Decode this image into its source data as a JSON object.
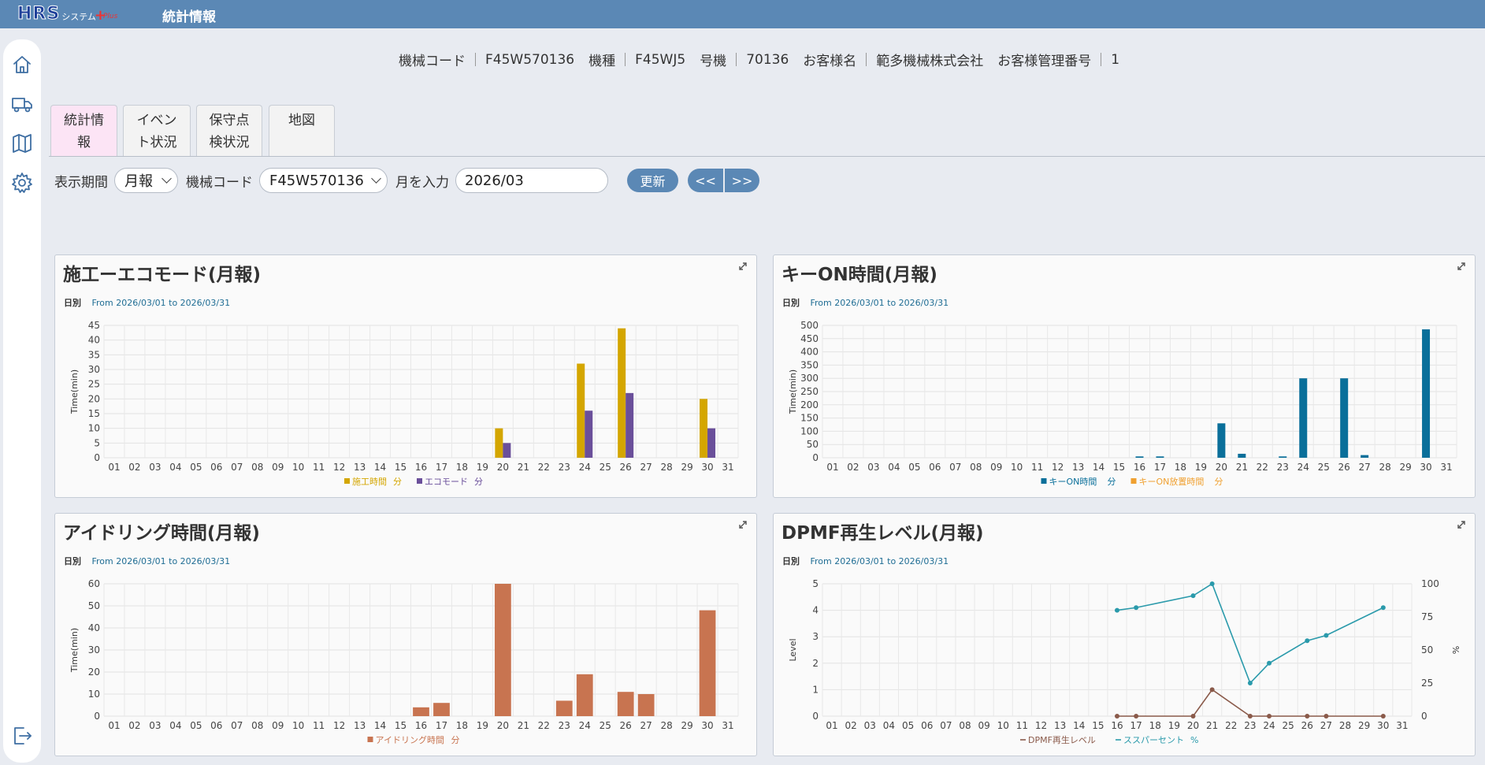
{
  "header": {
    "logo": {
      "brand": "HRS",
      "suffix": "システム",
      "plus": "+",
      "plus_sub": "Plus"
    },
    "title": "統計情報"
  },
  "sidebar": {
    "items": [
      {
        "icon": "home-icon"
      },
      {
        "icon": "truck-icon"
      },
      {
        "icon": "map-icon"
      },
      {
        "icon": "gear-icon"
      },
      {
        "icon": "logout-icon"
      }
    ]
  },
  "machine_info": {
    "code_label": "機械コード",
    "code_value": "F45W570136",
    "model_label": "機種",
    "model_value": "F45WJ5",
    "unit_label": "号機",
    "unit_value": "70136",
    "customer_label": "お客様名",
    "customer_value": "範多機械株式会社",
    "mgmt_label": "お客様管理番号",
    "mgmt_value": "1"
  },
  "tabs": [
    {
      "line1": "統計情",
      "line2": "報",
      "active": true
    },
    {
      "line1": "イベン",
      "line2": "ト状況",
      "active": false
    },
    {
      "line1": "保守点",
      "line2": "検状況",
      "active": false
    },
    {
      "line1": "地図",
      "line2": "",
      "active": false
    }
  ],
  "controls": {
    "period_label": "表示期間",
    "period_value": "月報",
    "machine_label": "機械コード",
    "machine_value": "F45W570136",
    "month_label": "月を入力",
    "month_value": "2026/03",
    "refresh_label": "更新",
    "prev_label": "<<",
    "next_label": ">>"
  },
  "panels": [
    {
      "title": "施工ーエコモード(月報)",
      "day_label": "日別",
      "range": "From 2026/03/01 to 2026/03/31"
    },
    {
      "title": "キーON時間(月報)",
      "day_label": "日別",
      "range": "From 2026/03/01 to 2026/03/31"
    },
    {
      "title": "アイドリング時間(月報)",
      "day_label": "日別",
      "range": "From 2026/03/01 to 2026/03/31"
    },
    {
      "title": "DPMF再生レベル(月報)",
      "day_label": "日別",
      "range": "From 2026/03/01 to 2026/03/31"
    }
  ],
  "chart_data": [
    {
      "type": "bar",
      "categories": [
        "01",
        "02",
        "03",
        "04",
        "05",
        "06",
        "07",
        "08",
        "09",
        "10",
        "11",
        "12",
        "13",
        "14",
        "15",
        "16",
        "17",
        "18",
        "19",
        "20",
        "21",
        "22",
        "23",
        "24",
        "25",
        "26",
        "27",
        "28",
        "29",
        "30",
        "31"
      ],
      "ylabel": "Time(min)",
      "ylim": [
        0,
        45
      ],
      "yticks": [
        0,
        5,
        10,
        15,
        20,
        25,
        30,
        35,
        40,
        45
      ],
      "grid": true,
      "legend_position": "bottom",
      "series": [
        {
          "name": "施工時間",
          "unit": "分",
          "color": "#d4a600",
          "values": [
            0,
            0,
            0,
            0,
            0,
            0,
            0,
            0,
            0,
            0,
            0,
            0,
            0,
            0,
            0,
            0,
            0,
            0,
            0,
            10,
            0,
            0,
            0,
            32,
            0,
            44,
            0,
            0,
            0,
            20,
            0
          ]
        },
        {
          "name": "エコモード",
          "unit": "分",
          "color": "#6a4f9a",
          "values": [
            0,
            0,
            0,
            0,
            0,
            0,
            0,
            0,
            0,
            0,
            0,
            0,
            0,
            0,
            0,
            0,
            0,
            0,
            0,
            5,
            0,
            0,
            0,
            16,
            0,
            22,
            0,
            0,
            0,
            10,
            0
          ]
        }
      ]
    },
    {
      "type": "bar",
      "categories": [
        "01",
        "02",
        "03",
        "04",
        "05",
        "06",
        "07",
        "08",
        "09",
        "10",
        "11",
        "12",
        "13",
        "14",
        "15",
        "16",
        "17",
        "18",
        "19",
        "20",
        "21",
        "22",
        "23",
        "24",
        "25",
        "26",
        "27",
        "28",
        "29",
        "30",
        "31"
      ],
      "ylabel": "Time(min)",
      "ylim": [
        0,
        500
      ],
      "yticks": [
        0,
        50,
        100,
        150,
        200,
        250,
        300,
        350,
        400,
        450,
        500
      ],
      "grid": true,
      "legend_position": "bottom",
      "series": [
        {
          "name": "キーON時間",
          "unit": "分",
          "color": "#0a6f9a",
          "values": [
            0,
            0,
            0,
            0,
            0,
            0,
            0,
            0,
            0,
            0,
            0,
            0,
            0,
            0,
            0,
            5,
            5,
            0,
            0,
            130,
            15,
            0,
            5,
            300,
            0,
            300,
            10,
            0,
            0,
            485,
            0
          ]
        },
        {
          "name": "キーON放置時間",
          "unit": "分",
          "color": "#f0a030",
          "values": [
            0,
            0,
            0,
            0,
            0,
            0,
            0,
            0,
            0,
            0,
            0,
            0,
            0,
            0,
            0,
            0,
            0,
            0,
            0,
            0,
            0,
            0,
            0,
            0,
            0,
            0,
            0,
            0,
            0,
            0,
            0
          ]
        }
      ]
    },
    {
      "type": "bar",
      "categories": [
        "01",
        "02",
        "03",
        "04",
        "05",
        "06",
        "07",
        "08",
        "09",
        "10",
        "11",
        "12",
        "13",
        "14",
        "15",
        "16",
        "17",
        "18",
        "19",
        "20",
        "21",
        "22",
        "23",
        "24",
        "25",
        "26",
        "27",
        "28",
        "29",
        "30",
        "31"
      ],
      "ylabel": "Time(min)",
      "ylim": [
        0,
        60
      ],
      "yticks": [
        0,
        10,
        20,
        30,
        40,
        50,
        60
      ],
      "grid": true,
      "legend_position": "bottom",
      "series": [
        {
          "name": "アイドリング時間",
          "unit": "分",
          "color": "#c87450",
          "values": [
            0,
            0,
            0,
            0,
            0,
            0,
            0,
            0,
            0,
            0,
            0,
            0,
            0,
            0,
            0,
            4,
            6,
            0,
            0,
            60,
            0,
            0,
            7,
            19,
            0,
            11,
            10,
            0,
            0,
            48,
            0
          ]
        }
      ]
    },
    {
      "type": "line",
      "categories": [
        "01",
        "02",
        "03",
        "04",
        "05",
        "06",
        "07",
        "08",
        "09",
        "10",
        "11",
        "12",
        "13",
        "14",
        "15",
        "16",
        "17",
        "18",
        "19",
        "20",
        "21",
        "22",
        "23",
        "24",
        "25",
        "26",
        "27",
        "28",
        "29",
        "30",
        "31"
      ],
      "ylabel": "Level",
      "ylim": [
        0,
        5
      ],
      "yticks": [
        0,
        1,
        2,
        3,
        4,
        5
      ],
      "y2label": "%",
      "y2lim": [
        0,
        100
      ],
      "y2ticks": [
        0,
        25,
        50,
        75,
        100
      ],
      "grid": true,
      "legend_position": "bottom",
      "series": [
        {
          "name": "DPMF再生レベル",
          "unit": "",
          "color": "#8a5a4a",
          "axis": "left",
          "points": [
            [
              "16",
              0
            ],
            [
              "17",
              0
            ],
            [
              "20",
              0
            ],
            [
              "21",
              1
            ],
            [
              "23",
              0
            ],
            [
              "24",
              0
            ],
            [
              "26",
              0
            ],
            [
              "27",
              0
            ],
            [
              "30",
              0
            ]
          ]
        },
        {
          "name": "ススパーセント",
          "unit": "%",
          "color": "#2a9aab",
          "axis": "right",
          "points": [
            [
              "16",
              80
            ],
            [
              "17",
              82
            ],
            [
              "20",
              91
            ],
            [
              "21",
              100
            ],
            [
              "23",
              25
            ],
            [
              "24",
              40
            ],
            [
              "26",
              57
            ],
            [
              "27",
              61
            ],
            [
              "30",
              82
            ]
          ]
        }
      ]
    }
  ]
}
